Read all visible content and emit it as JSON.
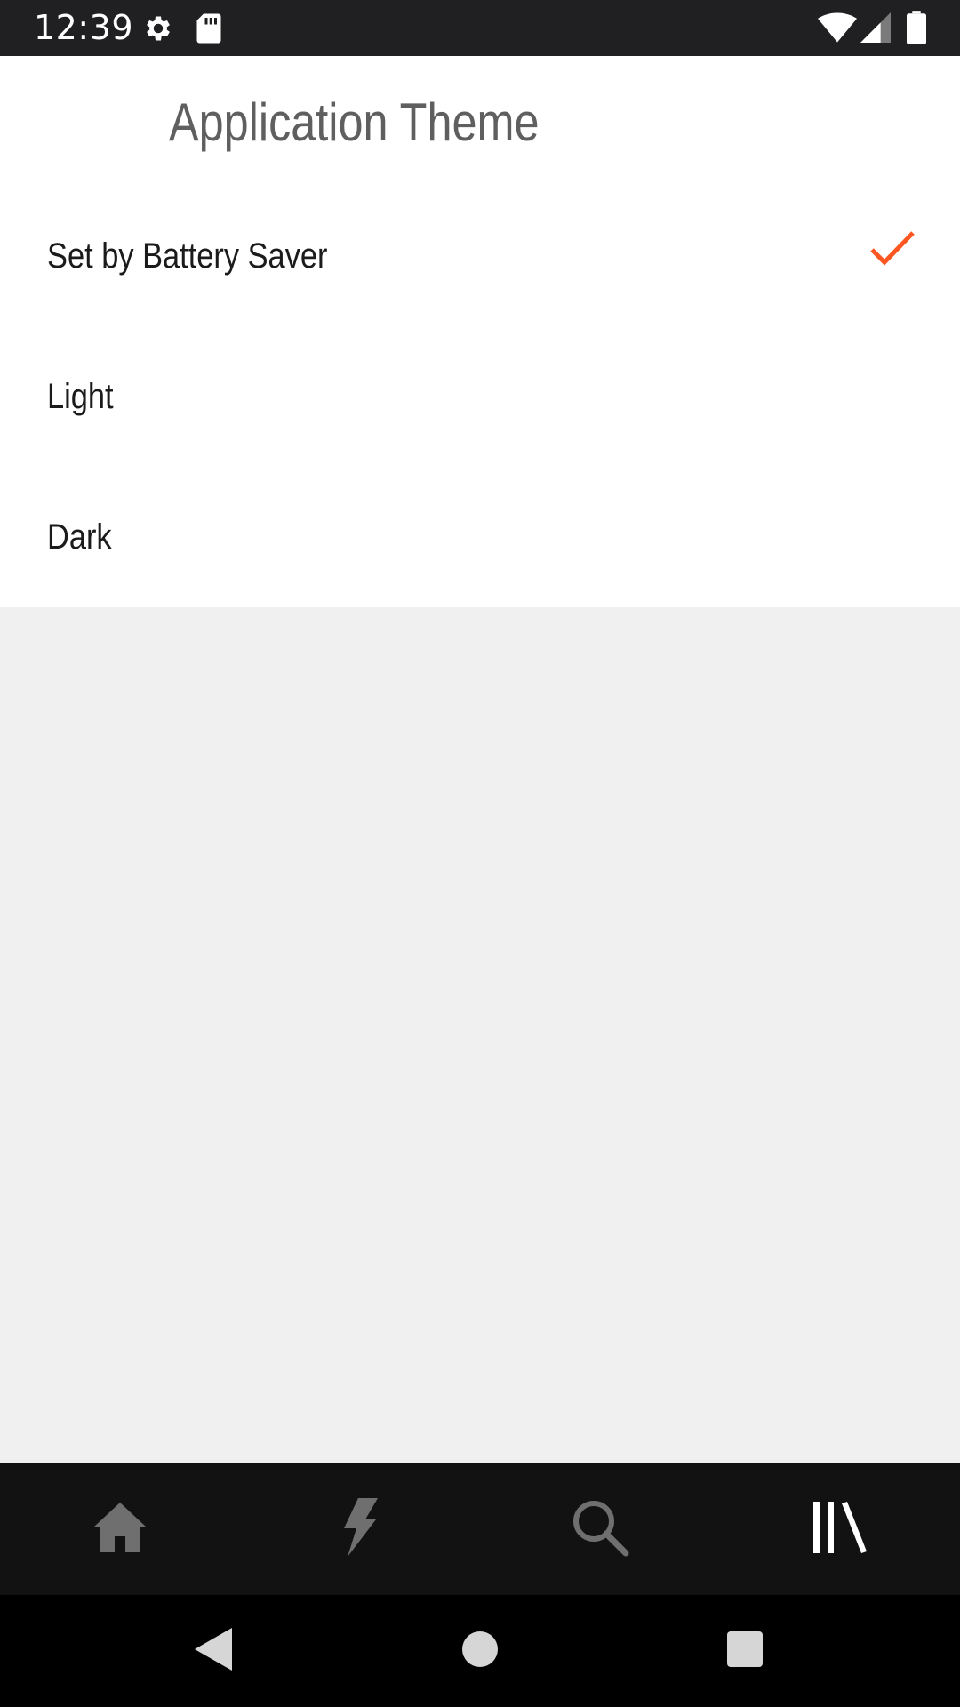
{
  "status_bar": {
    "time": "12:39",
    "icons": [
      "gear-icon",
      "sd-card-icon",
      "wifi-icon",
      "signal-icon",
      "battery-icon"
    ]
  },
  "dialog": {
    "title": "Application Theme",
    "options": [
      {
        "label": "Set by Battery Saver",
        "selected": true
      },
      {
        "label": "Light",
        "selected": false
      },
      {
        "label": "Dark",
        "selected": false
      }
    ],
    "accent_color": "#ff5722"
  },
  "bottom_nav": {
    "items": [
      {
        "icon": "home-icon",
        "active": false
      },
      {
        "icon": "lightning-icon",
        "active": false
      },
      {
        "icon": "search-icon",
        "active": false
      },
      {
        "icon": "library-icon",
        "active": true
      }
    ]
  },
  "system_nav": {
    "buttons": [
      "back-icon",
      "home-circle-icon",
      "recents-icon"
    ]
  }
}
